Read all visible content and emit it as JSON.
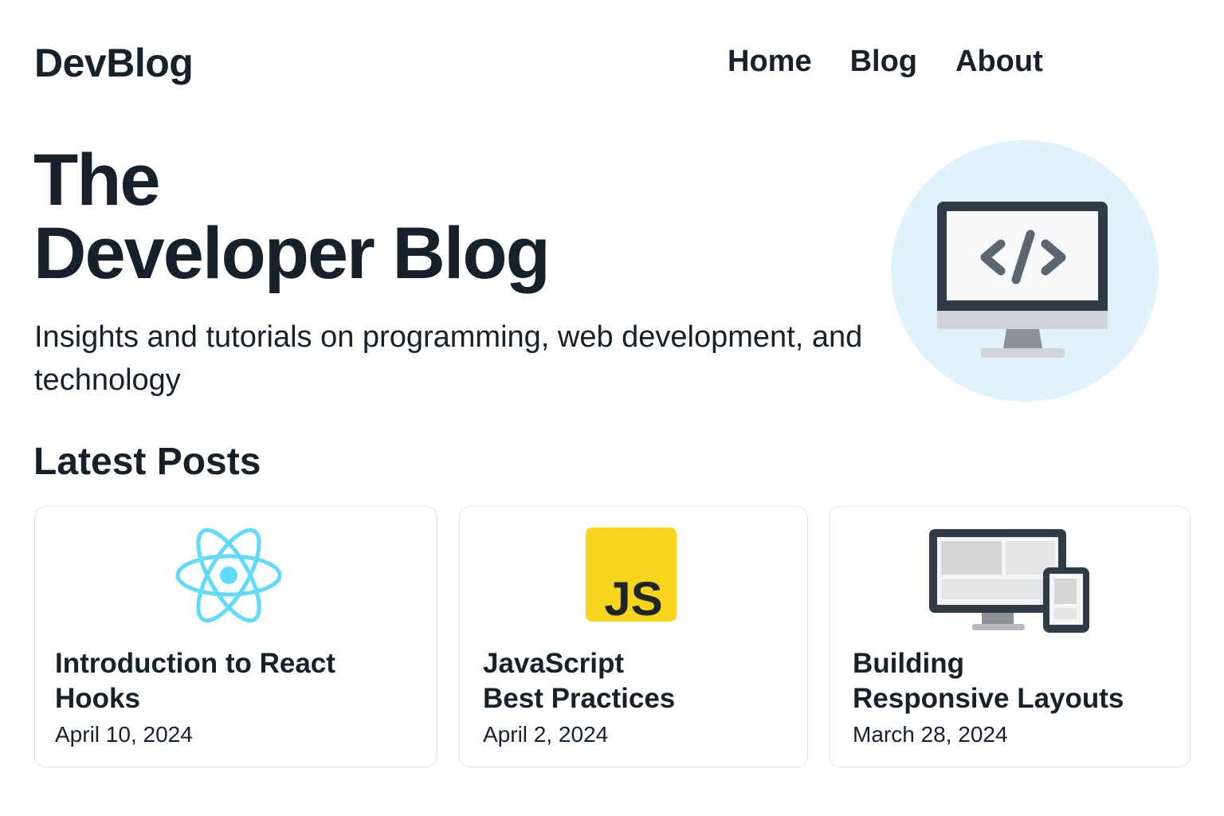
{
  "header": {
    "logo": "DevBlog",
    "nav": [
      "Home",
      "Blog",
      "About"
    ]
  },
  "hero": {
    "title_line1": "The",
    "title_line2": "Developer Blog",
    "subtitle": "Insights and tutorials on programming, web development, and technology",
    "illustration_icon": "monitor-code-icon"
  },
  "latest": {
    "heading": "Latest Posts",
    "posts": [
      {
        "title_line1": "Introduction to React",
        "title_line2": "Hooks",
        "date": "April 10, 2024",
        "icon": "react-icon"
      },
      {
        "title_line1": "JavaScript",
        "title_line2": "Best Practices",
        "date": "April 2, 2024",
        "icon": "javascript-icon",
        "icon_text": "JS"
      },
      {
        "title_line1": "Building",
        "title_line2": "Responsive Layouts",
        "date": "March 28, 2024",
        "icon": "responsive-devices-icon"
      }
    ]
  },
  "colors": {
    "text": "#17212b",
    "hero_circle": "#e0f2fc",
    "react_blue": "#61dafb",
    "js_yellow": "#f7d51d",
    "card_border": "#dfe3e8"
  }
}
